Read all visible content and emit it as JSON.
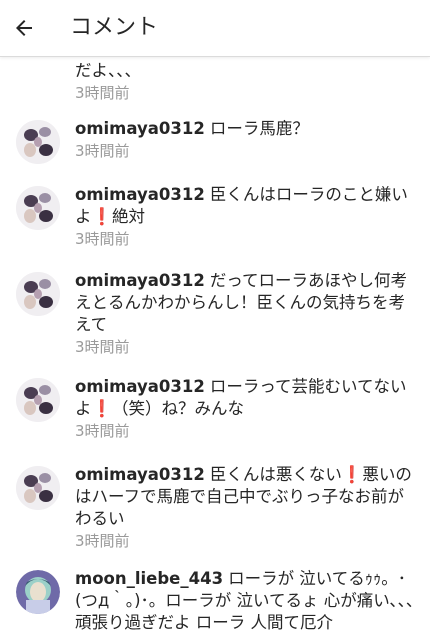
{
  "header": {
    "title": "コメント"
  },
  "partial_comment": {
    "text": "だよ、、、",
    "time": "3時間前"
  },
  "comments": [
    {
      "user": "omimaya0312",
      "parts": [
        {
          "t": "ローラ馬鹿？"
        }
      ],
      "time": "3時間前"
    },
    {
      "user": "omimaya0312",
      "parts": [
        {
          "t": "臣くんはローラのこと嫌いよ"
        },
        {
          "t": "❗",
          "excl": true
        },
        {
          "t": "絶対"
        }
      ],
      "time": "3時間前"
    },
    {
      "user": "omimaya0312",
      "parts": [
        {
          "t": "だってローラあほやし何考えとるんかわからんし！臣くんの気持ちを考えて"
        }
      ],
      "time": "3時間前"
    },
    {
      "user": "omimaya0312",
      "parts": [
        {
          "t": "ローラって芸能むいてないよ"
        },
        {
          "t": "❗",
          "excl": true
        },
        {
          "t": "（笑）ね？みんな"
        }
      ],
      "time": "3時間前"
    },
    {
      "user": "omimaya0312",
      "parts": [
        {
          "t": "臣くんは悪くない"
        },
        {
          "t": "❗",
          "excl": true
        },
        {
          "t": "悪いのはハーフで馬鹿で自己中でぶりっ子なお前がわるい"
        }
      ],
      "time": "3時間前"
    },
    {
      "user": "moon_liebe_443",
      "parts": [
        {
          "t": "ローラが 泣いてるｩｩ。･(つд｀｡)･。ローラが 泣いてるょ 心が痛い､､､頑張り過ぎだよ ローラ 人間て厄介"
        }
      ],
      "time": ""
    }
  ],
  "colors": {
    "text": "#262626",
    "meta": "#9a9a9a",
    "exclamation": "#e0102e",
    "divider": "#dbdbdb"
  }
}
